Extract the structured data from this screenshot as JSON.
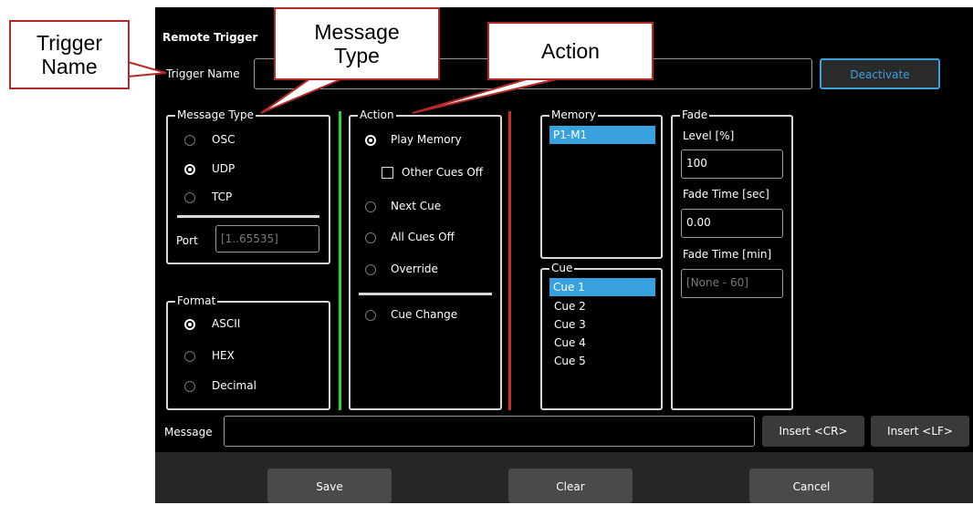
{
  "dialog": {
    "title": "Remote Trigger",
    "trigger_name_label": "Trigger Name",
    "trigger_name_value": "",
    "deactivate_label": "Deactivate"
  },
  "message_type": {
    "legend": "Message Type",
    "options": [
      "OSC",
      "UDP",
      "TCP"
    ],
    "selected": "UDP",
    "port_label": "Port",
    "port_placeholder": "[1..65535]"
  },
  "format": {
    "legend": "Format",
    "options": [
      "ASCII",
      "HEX",
      "Decimal"
    ],
    "selected": "ASCII"
  },
  "action": {
    "legend": "Action",
    "play_memory": "Play Memory",
    "other_cues_off": "Other Cues Off",
    "next_cue": "Next Cue",
    "all_cues_off": "All Cues Off",
    "override": "Override",
    "cue_change": "Cue Change",
    "selected": "Play Memory"
  },
  "memory": {
    "legend": "Memory",
    "items": [
      "P1-M1"
    ],
    "selected": "P1-M1"
  },
  "cue": {
    "legend": "Cue",
    "items": [
      "Cue 1",
      "Cue 2",
      "Cue 3",
      "Cue 4",
      "Cue 5"
    ],
    "selected": "Cue 1"
  },
  "fade": {
    "legend": "Fade",
    "level_label": "Level [%]",
    "level_value": "100",
    "fade_sec_label": "Fade Time [sec]",
    "fade_sec_value": "0.00",
    "fade_min_label": "Fade Time [min]",
    "fade_min_placeholder": "[None - 60]"
  },
  "message": {
    "label": "Message",
    "value": "",
    "insert_cr": "Insert <CR>",
    "insert_lf": "Insert <LF>"
  },
  "footer": {
    "save": "Save",
    "clear": "Clear",
    "cancel": "Cancel"
  },
  "callouts": {
    "trigger_name": "Trigger\nName",
    "message_type": "Message\nType",
    "action": "Action"
  },
  "colors": {
    "accent": "#3aa1df",
    "callout_border": "#b22a2a",
    "green_divider": "#2fd12f",
    "red_divider": "#d42a2a"
  }
}
